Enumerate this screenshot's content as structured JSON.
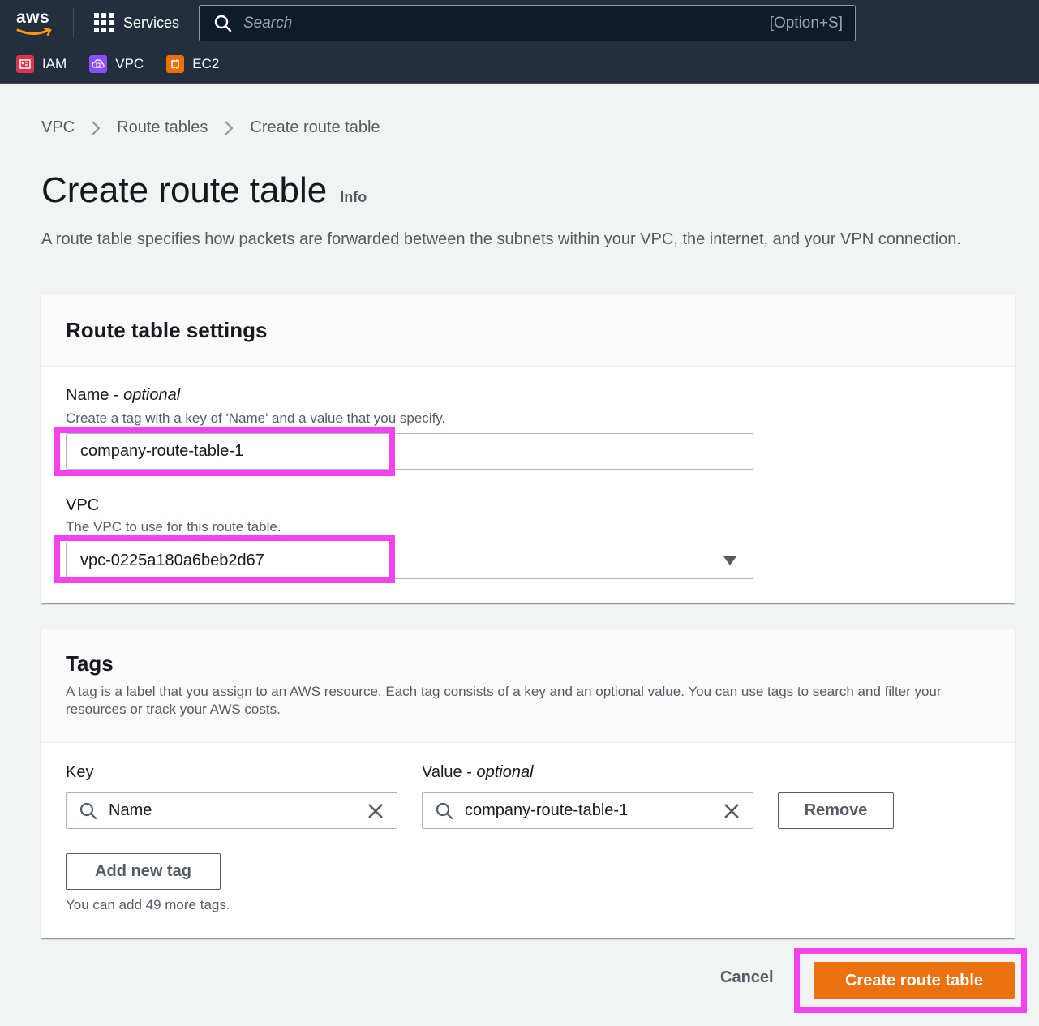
{
  "nav": {
    "logo_text": "aws",
    "services_label": "Services",
    "search_placeholder": "Search",
    "search_shortcut": "[Option+S]",
    "favorites": [
      {
        "label": "IAM",
        "icon": "iam-icon",
        "color": "#dd344c"
      },
      {
        "label": "VPC",
        "icon": "vpc-icon",
        "color": "#8c4fff"
      },
      {
        "label": "EC2",
        "icon": "ec2-icon",
        "color": "#ed7100"
      }
    ]
  },
  "breadcrumb": [
    "VPC",
    "Route tables",
    "Create route table"
  ],
  "page": {
    "title": "Create route table",
    "info": "Info",
    "description": "A route table specifies how packets are forwarded between the subnets within your VPC, the internet, and your VPN connection."
  },
  "settings": {
    "title": "Route table settings",
    "name_label": "Name - ",
    "name_label_optional": "optional",
    "name_desc": "Create a tag with a key of 'Name' and a value that you specify.",
    "name_value": "company-route-table-1",
    "vpc_label": "VPC",
    "vpc_desc": "The VPC to use for this route table.",
    "vpc_value": "vpc-0225a180a6beb2d67"
  },
  "tags": {
    "title": "Tags",
    "description": "A tag is a label that you assign to an AWS resource. Each tag consists of a key and an optional value. You can use tags to search and filter your resources or track your AWS costs.",
    "key_label": "Key",
    "value_label": "Value - ",
    "value_label_optional": "optional",
    "key_value": "Name",
    "value_value": "company-route-table-1",
    "remove_label": "Remove",
    "add_label": "Add new tag",
    "note": "You can add 49 more tags."
  },
  "actions": {
    "cancel": "Cancel",
    "create": "Create route table"
  },
  "colors": {
    "accent": "#ec7211",
    "highlight": "#f542ee",
    "nav_bg": "#232f3e"
  }
}
